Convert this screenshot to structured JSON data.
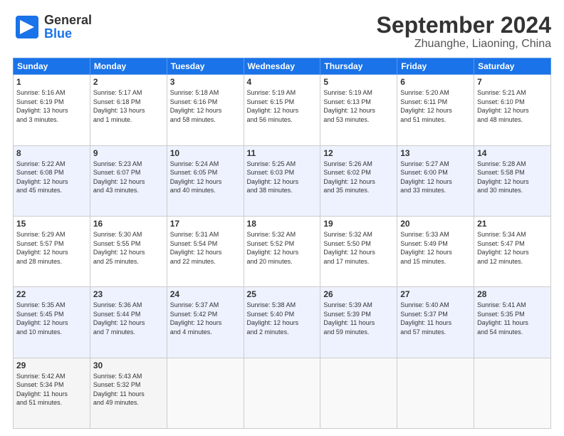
{
  "header": {
    "logo_general": "General",
    "logo_blue": "Blue",
    "month": "September 2024",
    "location": "Zhuanghe, Liaoning, China"
  },
  "weekdays": [
    "Sunday",
    "Monday",
    "Tuesday",
    "Wednesday",
    "Thursday",
    "Friday",
    "Saturday"
  ],
  "weeks": [
    [
      {
        "day": "1",
        "info": "Sunrise: 5:16 AM\nSunset: 6:19 PM\nDaylight: 13 hours\nand 3 minutes."
      },
      {
        "day": "2",
        "info": "Sunrise: 5:17 AM\nSunset: 6:18 PM\nDaylight: 13 hours\nand 1 minute."
      },
      {
        "day": "3",
        "info": "Sunrise: 5:18 AM\nSunset: 6:16 PM\nDaylight: 12 hours\nand 58 minutes."
      },
      {
        "day": "4",
        "info": "Sunrise: 5:19 AM\nSunset: 6:15 PM\nDaylight: 12 hours\nand 56 minutes."
      },
      {
        "day": "5",
        "info": "Sunrise: 5:19 AM\nSunset: 6:13 PM\nDaylight: 12 hours\nand 53 minutes."
      },
      {
        "day": "6",
        "info": "Sunrise: 5:20 AM\nSunset: 6:11 PM\nDaylight: 12 hours\nand 51 minutes."
      },
      {
        "day": "7",
        "info": "Sunrise: 5:21 AM\nSunset: 6:10 PM\nDaylight: 12 hours\nand 48 minutes."
      }
    ],
    [
      {
        "day": "8",
        "info": "Sunrise: 5:22 AM\nSunset: 6:08 PM\nDaylight: 12 hours\nand 45 minutes."
      },
      {
        "day": "9",
        "info": "Sunrise: 5:23 AM\nSunset: 6:07 PM\nDaylight: 12 hours\nand 43 minutes."
      },
      {
        "day": "10",
        "info": "Sunrise: 5:24 AM\nSunset: 6:05 PM\nDaylight: 12 hours\nand 40 minutes."
      },
      {
        "day": "11",
        "info": "Sunrise: 5:25 AM\nSunset: 6:03 PM\nDaylight: 12 hours\nand 38 minutes."
      },
      {
        "day": "12",
        "info": "Sunrise: 5:26 AM\nSunset: 6:02 PM\nDaylight: 12 hours\nand 35 minutes."
      },
      {
        "day": "13",
        "info": "Sunrise: 5:27 AM\nSunset: 6:00 PM\nDaylight: 12 hours\nand 33 minutes."
      },
      {
        "day": "14",
        "info": "Sunrise: 5:28 AM\nSunset: 5:58 PM\nDaylight: 12 hours\nand 30 minutes."
      }
    ],
    [
      {
        "day": "15",
        "info": "Sunrise: 5:29 AM\nSunset: 5:57 PM\nDaylight: 12 hours\nand 28 minutes."
      },
      {
        "day": "16",
        "info": "Sunrise: 5:30 AM\nSunset: 5:55 PM\nDaylight: 12 hours\nand 25 minutes."
      },
      {
        "day": "17",
        "info": "Sunrise: 5:31 AM\nSunset: 5:54 PM\nDaylight: 12 hours\nand 22 minutes."
      },
      {
        "day": "18",
        "info": "Sunrise: 5:32 AM\nSunset: 5:52 PM\nDaylight: 12 hours\nand 20 minutes."
      },
      {
        "day": "19",
        "info": "Sunrise: 5:32 AM\nSunset: 5:50 PM\nDaylight: 12 hours\nand 17 minutes."
      },
      {
        "day": "20",
        "info": "Sunrise: 5:33 AM\nSunset: 5:49 PM\nDaylight: 12 hours\nand 15 minutes."
      },
      {
        "day": "21",
        "info": "Sunrise: 5:34 AM\nSunset: 5:47 PM\nDaylight: 12 hours\nand 12 minutes."
      }
    ],
    [
      {
        "day": "22",
        "info": "Sunrise: 5:35 AM\nSunset: 5:45 PM\nDaylight: 12 hours\nand 10 minutes."
      },
      {
        "day": "23",
        "info": "Sunrise: 5:36 AM\nSunset: 5:44 PM\nDaylight: 12 hours\nand 7 minutes."
      },
      {
        "day": "24",
        "info": "Sunrise: 5:37 AM\nSunset: 5:42 PM\nDaylight: 12 hours\nand 4 minutes."
      },
      {
        "day": "25",
        "info": "Sunrise: 5:38 AM\nSunset: 5:40 PM\nDaylight: 12 hours\nand 2 minutes."
      },
      {
        "day": "26",
        "info": "Sunrise: 5:39 AM\nSunset: 5:39 PM\nDaylight: 11 hours\nand 59 minutes."
      },
      {
        "day": "27",
        "info": "Sunrise: 5:40 AM\nSunset: 5:37 PM\nDaylight: 11 hours\nand 57 minutes."
      },
      {
        "day": "28",
        "info": "Sunrise: 5:41 AM\nSunset: 5:35 PM\nDaylight: 11 hours\nand 54 minutes."
      }
    ],
    [
      {
        "day": "29",
        "info": "Sunrise: 5:42 AM\nSunset: 5:34 PM\nDaylight: 11 hours\nand 51 minutes."
      },
      {
        "day": "30",
        "info": "Sunrise: 5:43 AM\nSunset: 5:32 PM\nDaylight: 11 hours\nand 49 minutes."
      },
      {
        "day": "",
        "info": ""
      },
      {
        "day": "",
        "info": ""
      },
      {
        "day": "",
        "info": ""
      },
      {
        "day": "",
        "info": ""
      },
      {
        "day": "",
        "info": ""
      }
    ]
  ]
}
